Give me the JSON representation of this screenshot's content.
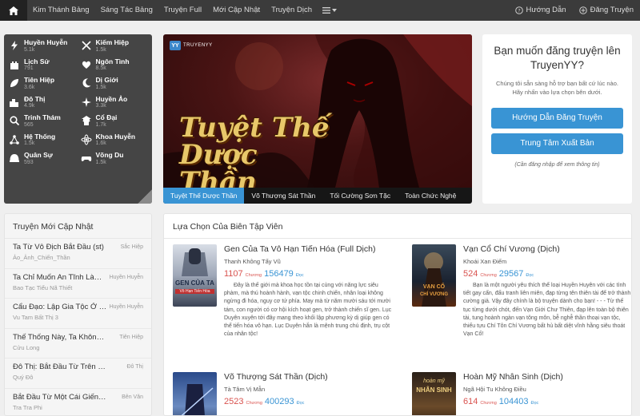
{
  "nav": {
    "links": [
      "Kim Thánh Bảng",
      "Sáng Tác Bảng",
      "Truyện Full",
      "Mới Cập Nhật",
      "Truyện Dịch"
    ],
    "guide": "Hướng Dẫn",
    "submit": "Đăng Truyện"
  },
  "genres": [
    {
      "name": "Huyền Huyễn",
      "count": "5.1k",
      "icon": "lightning-icon"
    },
    {
      "name": "Kiếm Hiệp",
      "count": "1.5k",
      "icon": "swords-icon"
    },
    {
      "name": "Lịch Sử",
      "count": "791",
      "icon": "castle-icon"
    },
    {
      "name": "Ngôn Tình",
      "count": "8.5k",
      "icon": "heart-icon"
    },
    {
      "name": "Tiên Hiệp",
      "count": "3.6k",
      "icon": "leaf-icon"
    },
    {
      "name": "Dị Giới",
      "count": "1.5k",
      "icon": "moon-icon"
    },
    {
      "name": "Đô Thị",
      "count": "4.9k",
      "icon": "city-icon"
    },
    {
      "name": "Huyền Ảo",
      "count": "3.3k",
      "icon": "sparkle-icon"
    },
    {
      "name": "Trinh Thám",
      "count": "565",
      "icon": "magnifier-icon"
    },
    {
      "name": "Cổ Đại",
      "count": "1.7k",
      "icon": "pagoda-icon"
    },
    {
      "name": "Hệ Thống",
      "count": "1.5k",
      "icon": "network-icon"
    },
    {
      "name": "Khoa Huyễn",
      "count": "1.6k",
      "icon": "atom-icon"
    },
    {
      "name": "Quân Sự",
      "count": "593",
      "icon": "helmet-icon"
    },
    {
      "name": "Võng Du",
      "count": "1.5k",
      "icon": "gamepad-icon"
    }
  ],
  "banner": {
    "logo": "TRUYENYY",
    "title": "Tuyệt Thế Dược Thần",
    "tabs": [
      "Tuyệt Thế Dược Thần",
      "Võ Thượng Sát Thần",
      "Tối Cường Sơn Tặc",
      "Toàn Chức Nghệ"
    ]
  },
  "register": {
    "title": "Bạn muốn đăng truyện lên TruyenYY?",
    "desc": "Chúng tôi sẵn sàng hỗ trợ bạn bất cứ lúc nào. Hãy nhấn vào lựa chọn bên dưới.",
    "btn_guide": "Hướng Dẫn Đăng Truyện",
    "btn_center": "Trung Tâm Xuất Bản",
    "note": "(Cần đăng nhập để xem thông tin)"
  },
  "updates": {
    "title": "Truyện Mới Cập Nhật",
    "items": [
      {
        "name": "Ta Từ Vô Địch Bắt Đầu (st)",
        "genre": "Sắc Hiệp",
        "author": "Ảo_Ảnh_Chiến_Thần"
      },
      {
        "name": "Ta Chỉ Muốn An Tĩnh Làm Ngư Nhân",
        "genre": "Huyền Huyễn",
        "author": "Bao Tạc Tiểu Nã Thiết"
      },
      {
        "name": "Cẩu Đạo: Lập Gia Tộc Ở Yêu Giới",
        "genre": "Huyền Huyễn",
        "author": "Vu Tam Bất Thị 3"
      },
      {
        "name": "Thế Thống Này, Ta Không Cần!",
        "genre": "Tiên Hiệp",
        "author": "Cửu Long"
      },
      {
        "name": "Đô Thị: Bắt Đầu Từ Trên Đường Cưới",
        "genre": "Đô Thị",
        "author": "Quý Đô"
      },
      {
        "name": "Bắt Đầu Từ Một Cái Giếng Biến Dị",
        "genre": "Bên Văn",
        "author": "Tra Tra Phi"
      }
    ]
  },
  "picks": {
    "title": "Lựa Chọn Của Biên Tập Viên",
    "chapter_label": "Chương",
    "view_label": "Đọc",
    "books": [
      {
        "title": "Gen Của Ta Vô Hạn Tiến Hóa (Full Dịch)",
        "author": "Thanh Không Tẩy Vũ",
        "chapters": "1107",
        "views": "156479",
        "cover_text": "GEN CỦA TA",
        "cover_sub": "Vô Hạn Tiến Hóa",
        "desc": "Đây là thế giới mà khoa học tồn tại cùng với năng lực siêu phàm, mà thú hoành hành, vạn tộc chinh chiến, nhân loại không ngừng đi hóa, nguy cơ tứ phía. May mà từ năm mười sáu tới mười tám, con người có cơ hội kích hoạt gen, trở thành chiến sĩ gen. Lục Duyên xuyên tới đây mang theo khối lập phương kỳ dị giúp gen có thể tiến hóa vô hạn. Lục Duyên hắn là mệnh trung chú định, trụ cột của nhân tộc!"
      },
      {
        "title": "Vạn Cổ Chí Vương (Dịch)",
        "author": "Khoái Xan Điếm",
        "chapters": "524",
        "views": "29567",
        "cover_text": "VẠN CỔ",
        "cover_sub": "CHÍ VƯƠNG",
        "desc": "Bạn là một người yêu thích thể loại Huyền Huyễn với các tình tiết gay cấn, đấu tranh liên miên, đạp từng tên thiên tài để trở thành cường giả. Vậy đây chính là bộ truyện dành cho bạn! - - - Từ thế tục từng dưới chót, đến Vạn Giới Chư Thiên, đạp lên toàn bộ thiên tài, tung hoành ngàn vạn tông môn, bễ nghễ thần thoại vạn tộc, thiếu tựu Chí Tôn Chí Vương bất hủ bất diệt vĩnh hằng siêu thoát Vạn Cổ!"
      },
      {
        "title": "Võ Thượng Sát Thần (Dịch)",
        "author": "Tà Tâm Vị Mẫn",
        "chapters": "2523",
        "views": "400293",
        "cover_text": "",
        "cover_sub": "",
        "desc": ""
      },
      {
        "title": "Hoàn Mỹ Nhân Sinh (Dịch)",
        "author": "Ngã Hội Tu Không Điều",
        "chapters": "614",
        "views": "104403",
        "cover_text": "hoàn mỹ",
        "cover_sub": "NHÂN SINH",
        "desc": ""
      }
    ]
  }
}
